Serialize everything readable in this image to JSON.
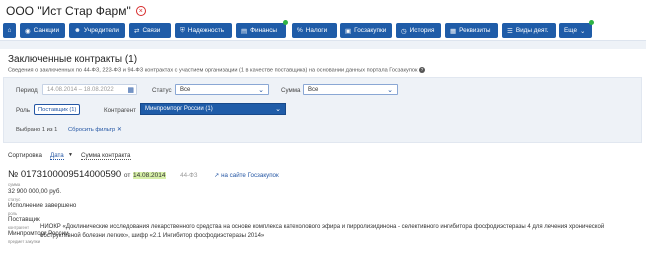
{
  "header": {
    "company": "ООО \"Ист Стар Фарм\"",
    "close_glyph": "×"
  },
  "nav": [
    {
      "label": "",
      "icon": "home-icon",
      "glyph": "⌂"
    },
    {
      "label": "Санкции",
      "icon": "globe-icon",
      "glyph": "◉"
    },
    {
      "label": "Учредители",
      "icon": "people-icon",
      "glyph": "☻"
    },
    {
      "label": "Связи",
      "icon": "link-icon",
      "glyph": "⇄"
    },
    {
      "label": "Надежность",
      "icon": "shield-icon",
      "glyph": "⛨"
    },
    {
      "label": "Финансы",
      "icon": "finance-icon",
      "glyph": "▤"
    },
    {
      "label": "Налоги",
      "icon": "percent-icon",
      "glyph": "%"
    },
    {
      "label": "Госзакупки",
      "icon": "tender-icon",
      "glyph": "▣"
    },
    {
      "label": "История",
      "icon": "history-icon",
      "glyph": "◷"
    },
    {
      "label": "Реквизиты",
      "icon": "requisites-icon",
      "glyph": "▦"
    },
    {
      "label": "Виды деят.",
      "icon": "list-icon",
      "glyph": "☰"
    },
    {
      "label": "Еще",
      "icon": "chevron-down-icon",
      "glyph": "⌄"
    }
  ],
  "section": {
    "title": "Заключенные контракты (1)",
    "subtitle": "Сведения о заключенных по 44-ФЗ, 223-ФЗ и 94-ФЗ контрактах с участием организации (1 в качестве поставщика) на основании данных портала Госзакупок"
  },
  "filters": {
    "period_label": "Период",
    "period_placeholder": "14.08.2014 – 18.08.2022",
    "status_label": "Статус",
    "status_value": "Все",
    "sum_label": "Сумма",
    "sum_value": "Все",
    "role_label": "Роль",
    "role_value": "Поставщик (1)",
    "kontragent_label": "Контрагент",
    "kontragent_value": "Минпромторг России (1)",
    "selected_text": "Выбрано 1 из 1",
    "reset_label": "Сбросить фильтр",
    "reset_glyph": "✕"
  },
  "sort": {
    "label": "Сортировка",
    "by_date": "Дата",
    "by_sum": "Сумма контракта"
  },
  "contract": {
    "number": "№ 0173100009514000590",
    "from_word": "от",
    "date": "14.08.2014",
    "law": "44-ФЗ",
    "portal_link": "на сайте Госзакупок",
    "sum_label": "сумма",
    "sum_value": "32 900 000,00 руб.",
    "status_label": "статус",
    "status_value": "Исполнение завершено",
    "role_label": "роль",
    "role_value": "Поставщик",
    "kontragent_label": "контрагент",
    "kontragent_value": "Минпромторг России",
    "subject_label": "предмет закупки",
    "subject_value": "НИОКР «Доклинические исследования лекарственного средства на основе комплекса катехолового эфира и пирролизидинона - селективного ингибитора фосфодиэстеразы 4 для лечения хронической обструктивной болезни легких», шифр «2.1 Ингибитор фосфодиэстеразы 2014»"
  }
}
